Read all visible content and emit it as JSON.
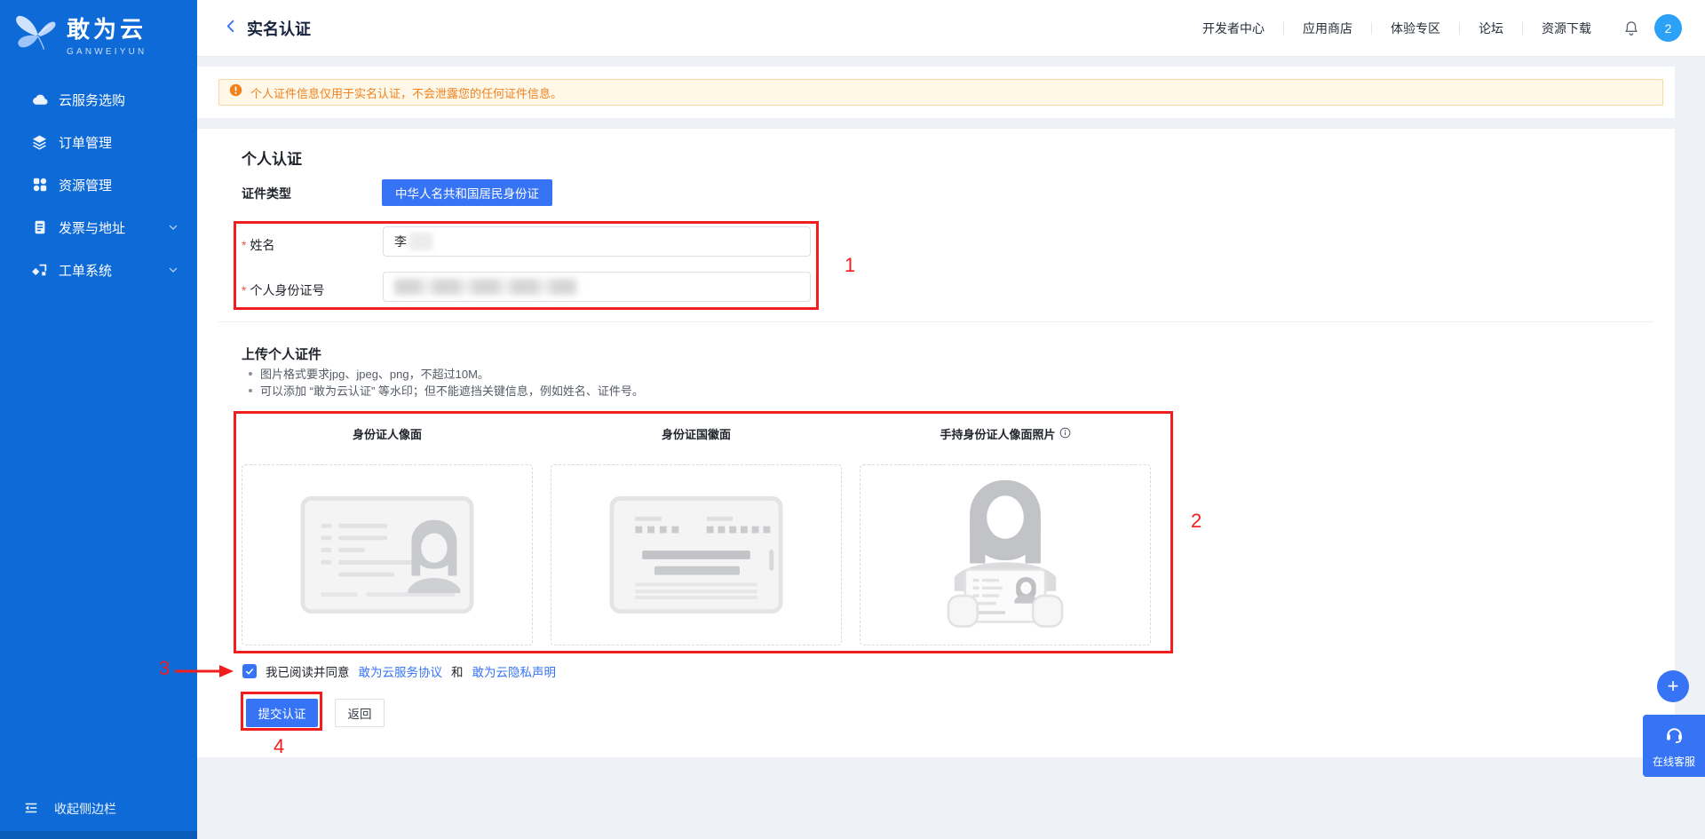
{
  "brand": {
    "name": "敢为云",
    "subtitle": "GANWEIYUN"
  },
  "sidebar": {
    "items": [
      {
        "label": "云服务选购",
        "icon": "cloud-icon",
        "has_submenu": false
      },
      {
        "label": "订单管理",
        "icon": "layers-icon",
        "has_submenu": false
      },
      {
        "label": "资源管理",
        "icon": "grid-icon",
        "has_submenu": false
      },
      {
        "label": "发票与地址",
        "icon": "invoice-icon",
        "has_submenu": true
      },
      {
        "label": "工单系统",
        "icon": "ticket-icon",
        "has_submenu": true
      }
    ],
    "collapse_label": "收起侧边栏"
  },
  "header": {
    "title": "实名认证",
    "nav": [
      "开发者中心",
      "应用商店",
      "体验专区",
      "论坛",
      "资源下载"
    ],
    "avatar_badge": "2"
  },
  "banner": {
    "text": "个人证件信息仅用于实名认证，不会泄露您的任何证件信息。"
  },
  "form": {
    "section_title": "个人认证",
    "cert_type_label": "证件类型",
    "cert_type_value": "中华人名共和国居民身份证",
    "required_marker": "*",
    "name_label": "姓名",
    "name_value": "李",
    "id_label": "个人身份证号",
    "upload_section_title": "上传个人证件",
    "upload_tips": [
      "图片格式要求jpg、jpeg、png，不超过10M。",
      "可以添加 “敢为云认证” 等水印；但不能遮挡关键信息，例如姓名、证件号。"
    ],
    "upload_slots": [
      {
        "label": "身份证人像面"
      },
      {
        "label": "身份证国徽面"
      },
      {
        "label": "手持身份证人像面照片"
      }
    ],
    "agreement": {
      "prefix": "我已阅读并同意",
      "service_link": "敢为云服务协议",
      "conjunction": "和",
      "privacy_link": "敢为云隐私声明"
    },
    "submit_label": "提交认证",
    "back_label": "返回"
  },
  "floating": {
    "plus_label": "+",
    "service_label": "在线客服"
  },
  "annotations": {
    "step1": "1",
    "step2": "2",
    "step3": "3",
    "step4": "4"
  },
  "colors": {
    "sidebar_blue": "#0d6ad7",
    "primary_blue": "#3674f5",
    "avatar_blue": "#2ba1f7",
    "annotation_red": "#f21d1d",
    "warning_orange": "#f0821e",
    "warning_bg": "#fff7e8"
  }
}
